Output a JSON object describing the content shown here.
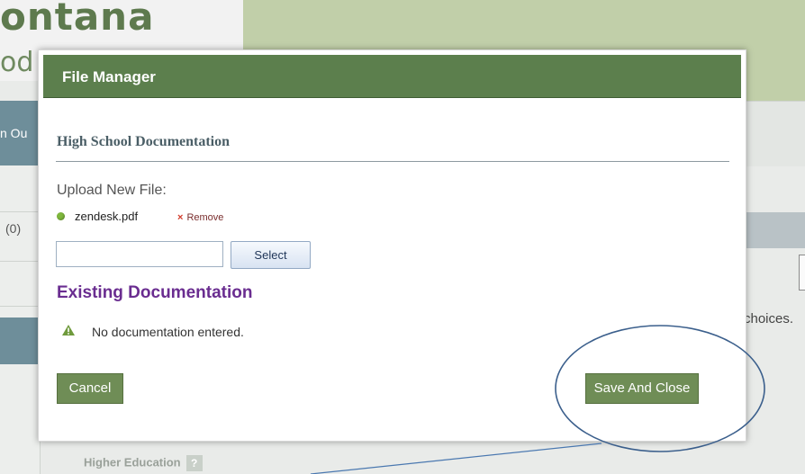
{
  "background": {
    "logo_line1": "ontana",
    "logo_line2": "od",
    "nav_tab_label": "n Ou",
    "count_label": "(0)",
    "right_text": "choices.",
    "higher_education_label": "Higher Education",
    "help_glyph": "?"
  },
  "modal": {
    "title": "File Manager",
    "section_title": "High School Documentation",
    "upload_label": "Upload New File:",
    "file": {
      "name": "zendesk.pdf",
      "status_color": "#7fb83d",
      "remove_label": "Remove",
      "remove_glyph": "×"
    },
    "file_input": {
      "value": "",
      "placeholder": ""
    },
    "select_label": "Select",
    "existing_title": "Existing Documentation",
    "empty_message": "No documentation entered.",
    "warning_icon": "warning-triangle-icon",
    "cancel_label": "Cancel",
    "save_label": "Save And Close"
  },
  "colors": {
    "header_green": "#5c7f4d",
    "button_green": "#6f8d56",
    "existing_purple": "#6a2d90",
    "annotation_blue": "#3b5f8c"
  }
}
